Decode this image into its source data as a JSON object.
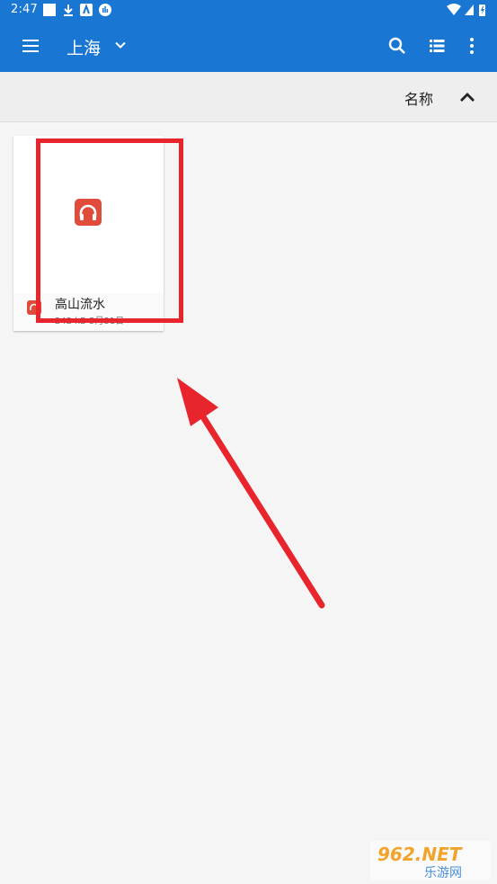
{
  "status_bar": {
    "time": "2:47"
  },
  "app_bar": {
    "title": "上海"
  },
  "sort_bar": {
    "label": "名称"
  },
  "files": [
    {
      "name": "高山流水",
      "meta": "242 kB  5月31日",
      "icon": "headphones-icon"
    }
  ],
  "watermark": {
    "top": "962.NET",
    "bottom": "乐游网"
  },
  "colors": {
    "primary": "#1976d2",
    "audio_icon": "#e04b3a",
    "annotation": "#e8242c"
  }
}
